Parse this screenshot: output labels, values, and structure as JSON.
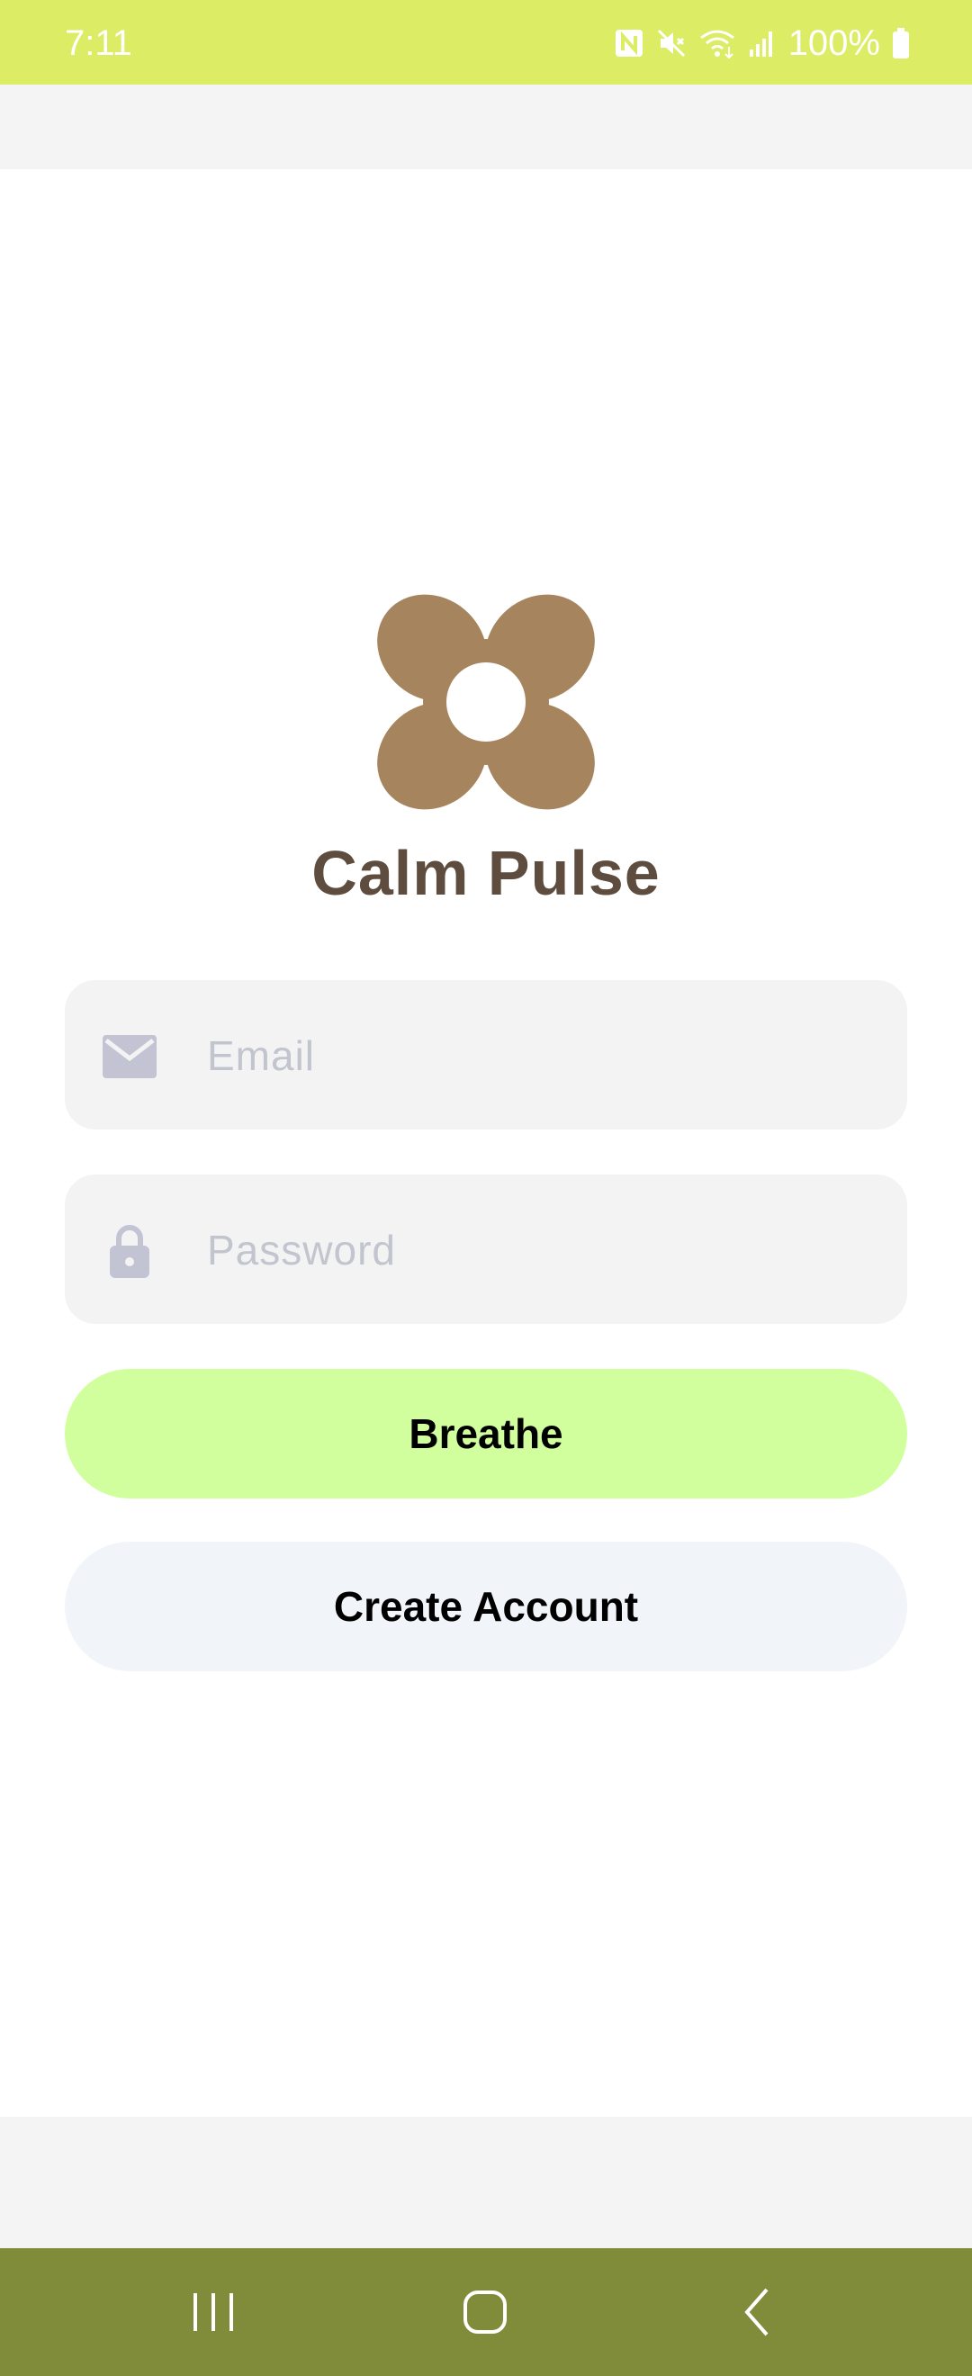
{
  "status_bar": {
    "time": "7:11",
    "battery": "100%",
    "icons": [
      "nfc-icon",
      "mute-icon",
      "wifi-icon",
      "signal-icon",
      "battery-icon"
    ]
  },
  "app": {
    "name": "Calm Pulse",
    "logo": "flower-logo-icon"
  },
  "login": {
    "email_placeholder": "Email",
    "email_value": "",
    "password_placeholder": "Password",
    "password_value": "",
    "primary_button": "Breathe",
    "secondary_button": "Create Account"
  },
  "colors": {
    "status_bar": "#dcec64",
    "logo": "#a5845e",
    "title": "#5e4d3f",
    "primary_button": "#d2ff9d",
    "secondary_button": "#f1f5f9",
    "nav_bar": "#808c3a",
    "input_bg": "#f3f3f4",
    "placeholder": "#c2c4ce"
  },
  "nav_bar": {
    "buttons": [
      "recents-icon",
      "home-icon",
      "back-icon"
    ]
  }
}
